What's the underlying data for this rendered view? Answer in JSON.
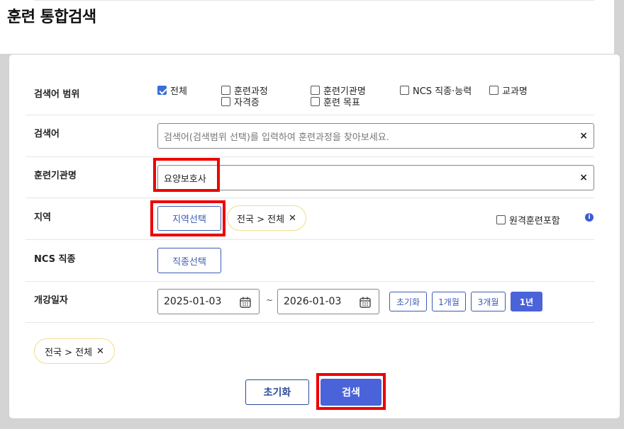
{
  "page": {
    "title": "훈련 통합검색"
  },
  "scope": {
    "label": "검색어 범위",
    "options": [
      {
        "label": "전체",
        "checked": true
      },
      {
        "label": "훈련과정",
        "checked": false
      },
      {
        "label": "훈련기관명",
        "checked": false
      },
      {
        "label": "NCS 직종·능력",
        "checked": false
      },
      {
        "label": "교과명",
        "checked": false
      },
      {
        "label": "자격증",
        "checked": false
      },
      {
        "label": "훈련 목표",
        "checked": false
      }
    ]
  },
  "keyword": {
    "label": "검색어",
    "placeholder": "검색어(검색범위 선택)를 입력하여 훈련과정을 찾아보세요.",
    "value": "",
    "clear": "×"
  },
  "institution": {
    "label": "훈련기관명",
    "value": "요양보호사",
    "clear": "×"
  },
  "region": {
    "label": "지역",
    "select_button": "지역선택",
    "tag": "전국 > 전체",
    "tag_close": "✕",
    "remote_label": "원격훈련포함",
    "remote_checked": false,
    "info_icon": "i"
  },
  "ncs": {
    "label": "NCS 직종",
    "select_button": "직종선택"
  },
  "date": {
    "label": "개강일자",
    "start": "2025-01-03",
    "separator": "~",
    "end": "2026-01-03",
    "periods": [
      {
        "label": "초기화",
        "active": false
      },
      {
        "label": "1개월",
        "active": false
      },
      {
        "label": "3개월",
        "active": false
      },
      {
        "label": "1년",
        "active": true
      }
    ]
  },
  "selected_filter": {
    "tag": "전국 > 전체",
    "close": "✕"
  },
  "actions": {
    "reset": "초기화",
    "search": "검색"
  },
  "colors": {
    "primary": "#4a63d9",
    "outline": "#3b5bb8",
    "highlight": "#ee0000",
    "tag_border": "#f0dc8c"
  }
}
